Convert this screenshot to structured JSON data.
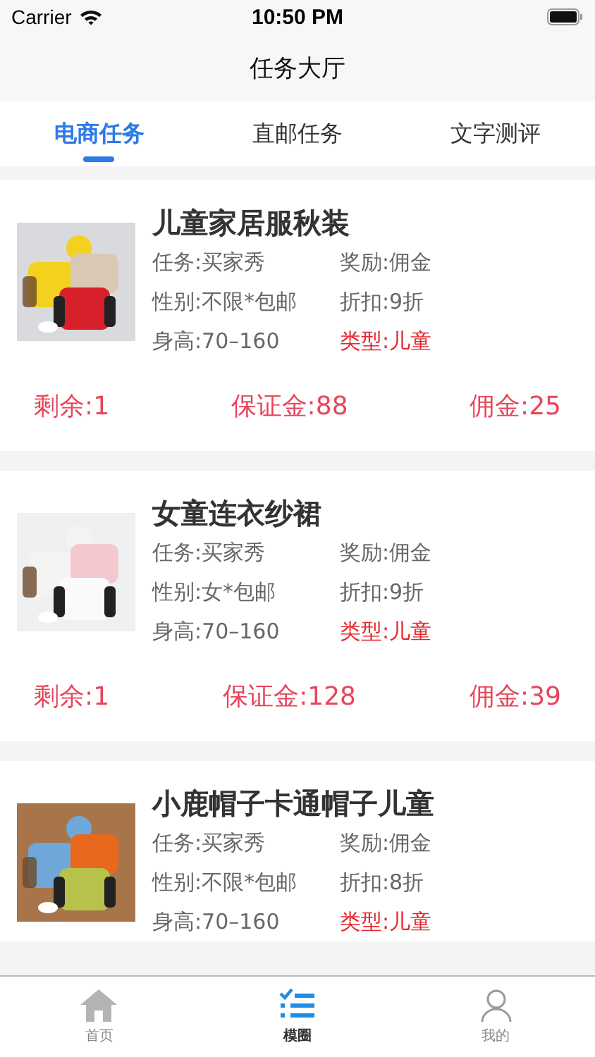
{
  "status_bar": {
    "carrier": "Carrier",
    "time": "10:50 PM"
  },
  "nav": {
    "title": "任务大厅"
  },
  "tabs": [
    {
      "label": "电商任务",
      "selected": true
    },
    {
      "label": "直邮任务",
      "selected": false
    },
    {
      "label": "文字测评",
      "selected": false
    }
  ],
  "tasks": [
    {
      "title": "儿童家居服秋装",
      "task": "任务:买家秀",
      "reward": "奖励:佣金",
      "gender": "性别:不限*包邮",
      "discount": "折扣:9折",
      "height": "身高:70–160",
      "type": "类型:儿童",
      "remaining": "剩余:1",
      "deposit": "保证金:88",
      "commission": "佣金:25"
    },
    {
      "title": "女童连衣纱裙",
      "task": "任务:买家秀",
      "reward": "奖励:佣金",
      "gender": "性别:女*包邮",
      "discount": "折扣:9折",
      "height": "身高:70–160",
      "type": "类型:儿童",
      "remaining": "剩余:1",
      "deposit": "保证金:128",
      "commission": "佣金:39"
    },
    {
      "title": "小鹿帽子卡通帽子儿童",
      "task": "任务:买家秀",
      "reward": "奖励:佣金",
      "gender": "性别:不限*包邮",
      "discount": "折扣:8折",
      "height": "身高:70–160",
      "type": "类型:儿童"
    }
  ],
  "tab_bar": [
    {
      "kind": "home",
      "label": "首页",
      "selected": false
    },
    {
      "kind": "list",
      "label": "模圈",
      "selected": true
    },
    {
      "kind": "person",
      "label": "我的",
      "selected": false
    }
  ]
}
